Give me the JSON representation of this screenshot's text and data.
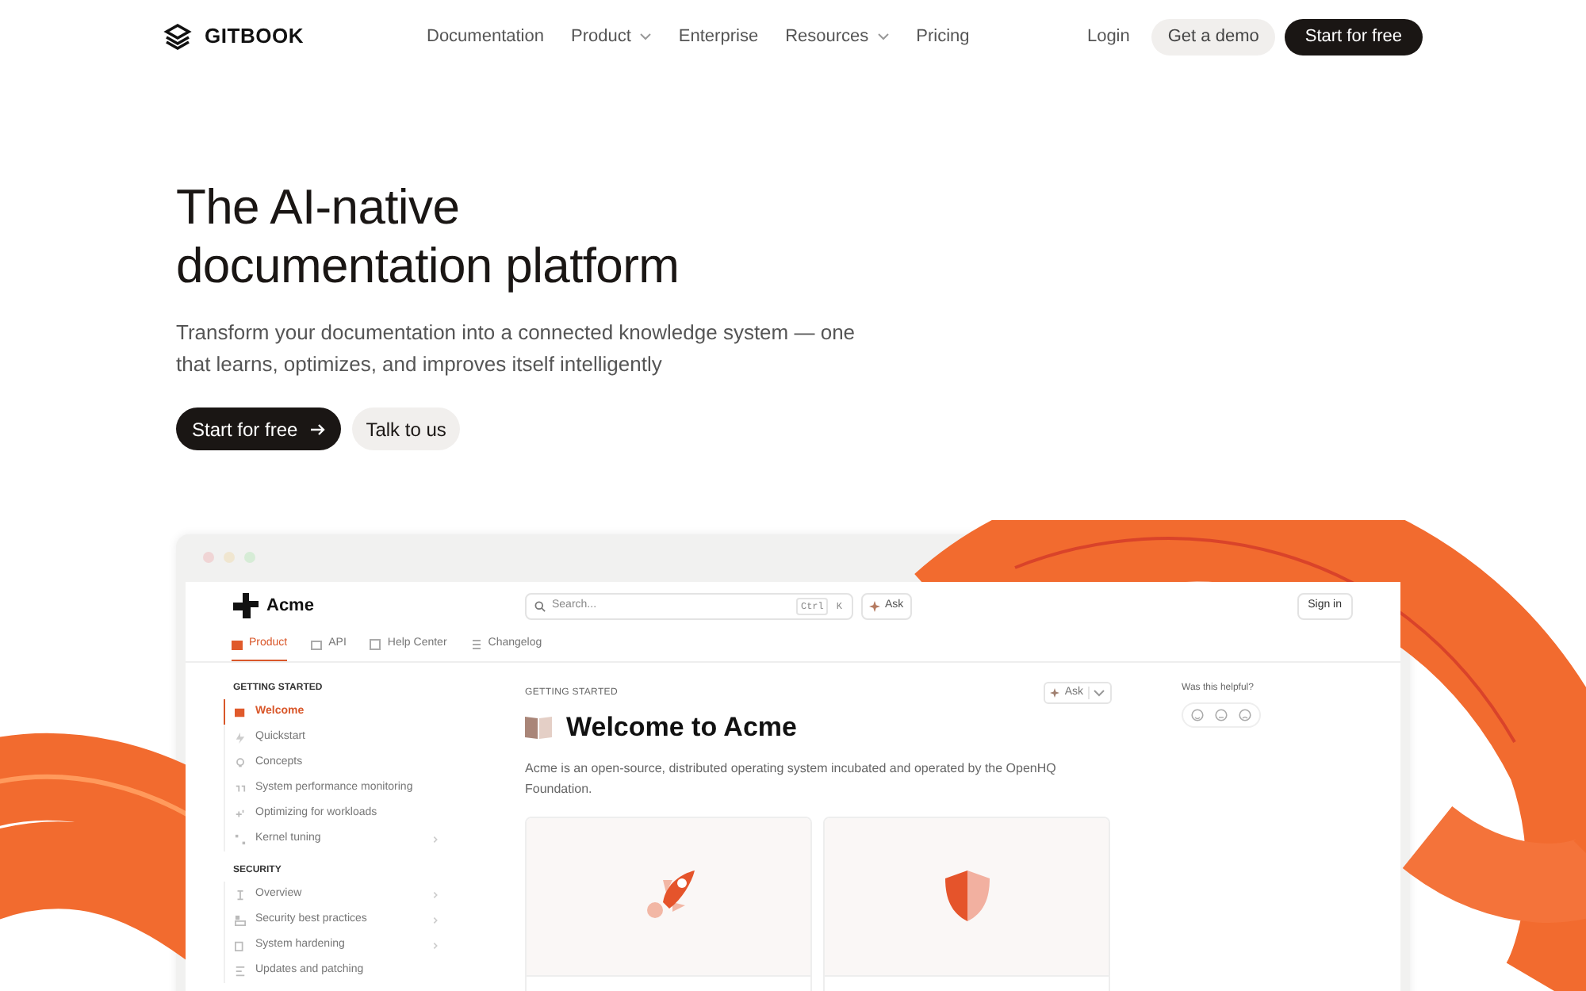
{
  "nav": {
    "brand": "GITBOOK",
    "links": [
      {
        "label": "Documentation",
        "dropdown": false
      },
      {
        "label": "Product",
        "dropdown": true
      },
      {
        "label": "Enterprise",
        "dropdown": false
      },
      {
        "label": "Resources",
        "dropdown": true
      },
      {
        "label": "Pricing",
        "dropdown": false
      }
    ],
    "login": "Login",
    "demo": "Get a demo",
    "start": "Start for free"
  },
  "hero": {
    "title_lines": [
      "The AI-native",
      "documentation platform"
    ],
    "subtitle_lines": [
      "Transform your documentation into a connected knowledge system — one",
      "that learns, optimizes, and improves itself intelligently"
    ],
    "primary": "Start for free",
    "secondary": "Talk to us"
  },
  "preview": {
    "brand": "Acme",
    "search": {
      "placeholder": "Search...",
      "shortcut": "Ctrl",
      "clear": "K"
    },
    "ask": "Ask",
    "sign_in": "Sign in",
    "tabs": [
      {
        "label": "Product",
        "selected": true
      },
      {
        "label": "API",
        "selected": false
      },
      {
        "label": "Help Center",
        "selected": false
      },
      {
        "label": "Changelog",
        "selected": false
      }
    ],
    "sidebar": [
      {
        "kind": "section",
        "label": "GETTING STARTED"
      },
      {
        "kind": "item",
        "label": "Welcome",
        "selected": true,
        "expandable": false
      },
      {
        "kind": "item",
        "label": "Quickstart",
        "selected": false,
        "expandable": false
      },
      {
        "kind": "item",
        "label": "Concepts",
        "selected": false,
        "expandable": false
      },
      {
        "kind": "item",
        "label": "System performance monitoring",
        "selected": false,
        "expandable": false
      },
      {
        "kind": "item",
        "label": "Optimizing for workloads",
        "selected": false,
        "expandable": false
      },
      {
        "kind": "item",
        "label": "Kernel tuning",
        "selected": false,
        "expandable": true
      },
      {
        "kind": "section",
        "label": "SECURITY"
      },
      {
        "kind": "item",
        "label": "Overview",
        "selected": false,
        "expandable": true
      },
      {
        "kind": "item",
        "label": "Security best practices",
        "selected": false,
        "expandable": true
      },
      {
        "kind": "item",
        "label": "System hardening",
        "selected": false,
        "expandable": true
      },
      {
        "kind": "item",
        "label": "Updates and patching",
        "selected": false,
        "expandable": false
      }
    ],
    "breadcrumb": "GETTING STARTED",
    "page_ask": "Ask",
    "title": "Welcome to Acme",
    "description": "Acme is an open-source, distributed operating system incubated and operated by the OpenHQ Foundation.",
    "cards": [
      {
        "kind": "rocket"
      },
      {
        "kind": "shield"
      }
    ],
    "feedback": "Was this helpful?"
  }
}
